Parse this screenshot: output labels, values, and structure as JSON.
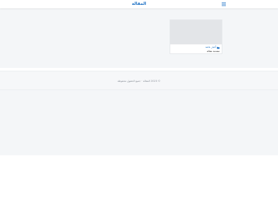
{
  "header": {
    "logo_text": "المقالة",
    "menu_icon": "hamburger-menu-icon"
  },
  "card": {
    "category_icon": "folder-icon",
    "category": "أخبار عامة",
    "title": "مقدمة مقالة"
  },
  "footer": {
    "copyright": "© 2023 المقالة · جميع الحقوق محفوظة"
  },
  "colors": {
    "accent": "#1a6fc4",
    "page_bg": "#f4f6f8",
    "image_placeholder": "#e3e5e8"
  }
}
